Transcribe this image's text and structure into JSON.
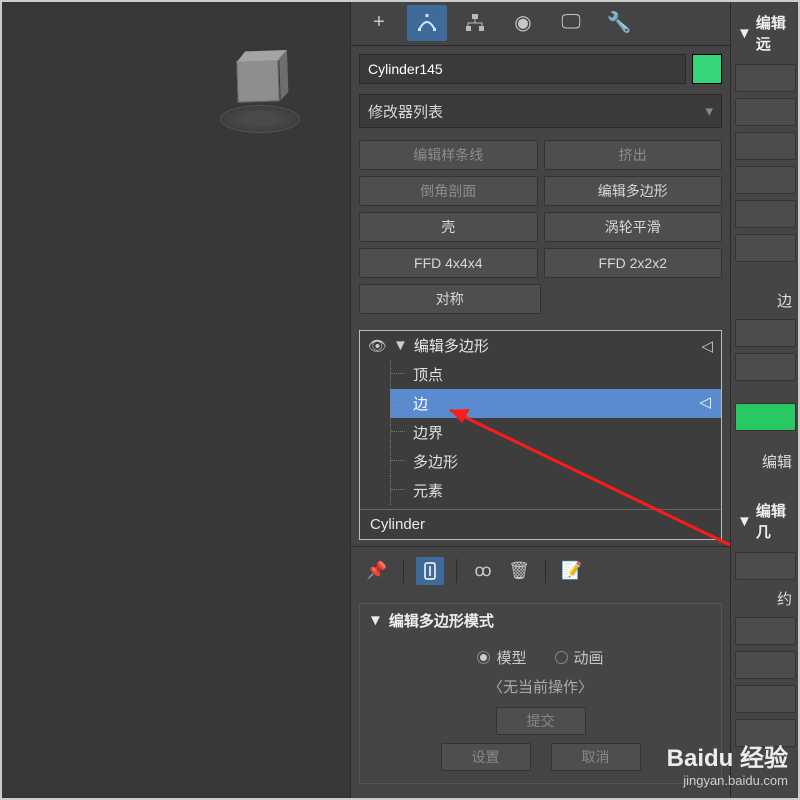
{
  "object_name": "Cylinder145",
  "modifier_dropdown": "修改器列表",
  "modifier_buttons": {
    "edit_spline": "编辑样条线",
    "extrude": "挤出",
    "bevel_section": "倒角剖面",
    "edit_poly": "编辑多边形",
    "shell": "壳",
    "turbosmooth": "涡轮平滑",
    "ffd4": "FFD 4x4x4",
    "ffd2": "FFD 2x2x2",
    "symmetry": "对称"
  },
  "stack": {
    "header": "编辑多边形",
    "items": [
      "顶点",
      "边",
      "边界",
      "多边形",
      "元素"
    ],
    "selected_index": 1,
    "base": "Cylinder"
  },
  "rollout_mode": {
    "title": "编辑多边形模式",
    "radio_model": "模型",
    "radio_anim": "动画",
    "no_op": "〈无当前操作〉",
    "commit": "提交",
    "settings": "设置",
    "cancel": "取消"
  },
  "right_strip": {
    "edit_far": "编辑远",
    "bian": "边",
    "edit_bian_title": "编辑",
    "edit_j": "编辑几",
    "yue": "约"
  },
  "watermark": {
    "brand": "Baidu 经验",
    "url": "jingyan.baidu.com"
  },
  "colors": {
    "object_color": "#35d67a",
    "selection": "#5b8bcf"
  }
}
